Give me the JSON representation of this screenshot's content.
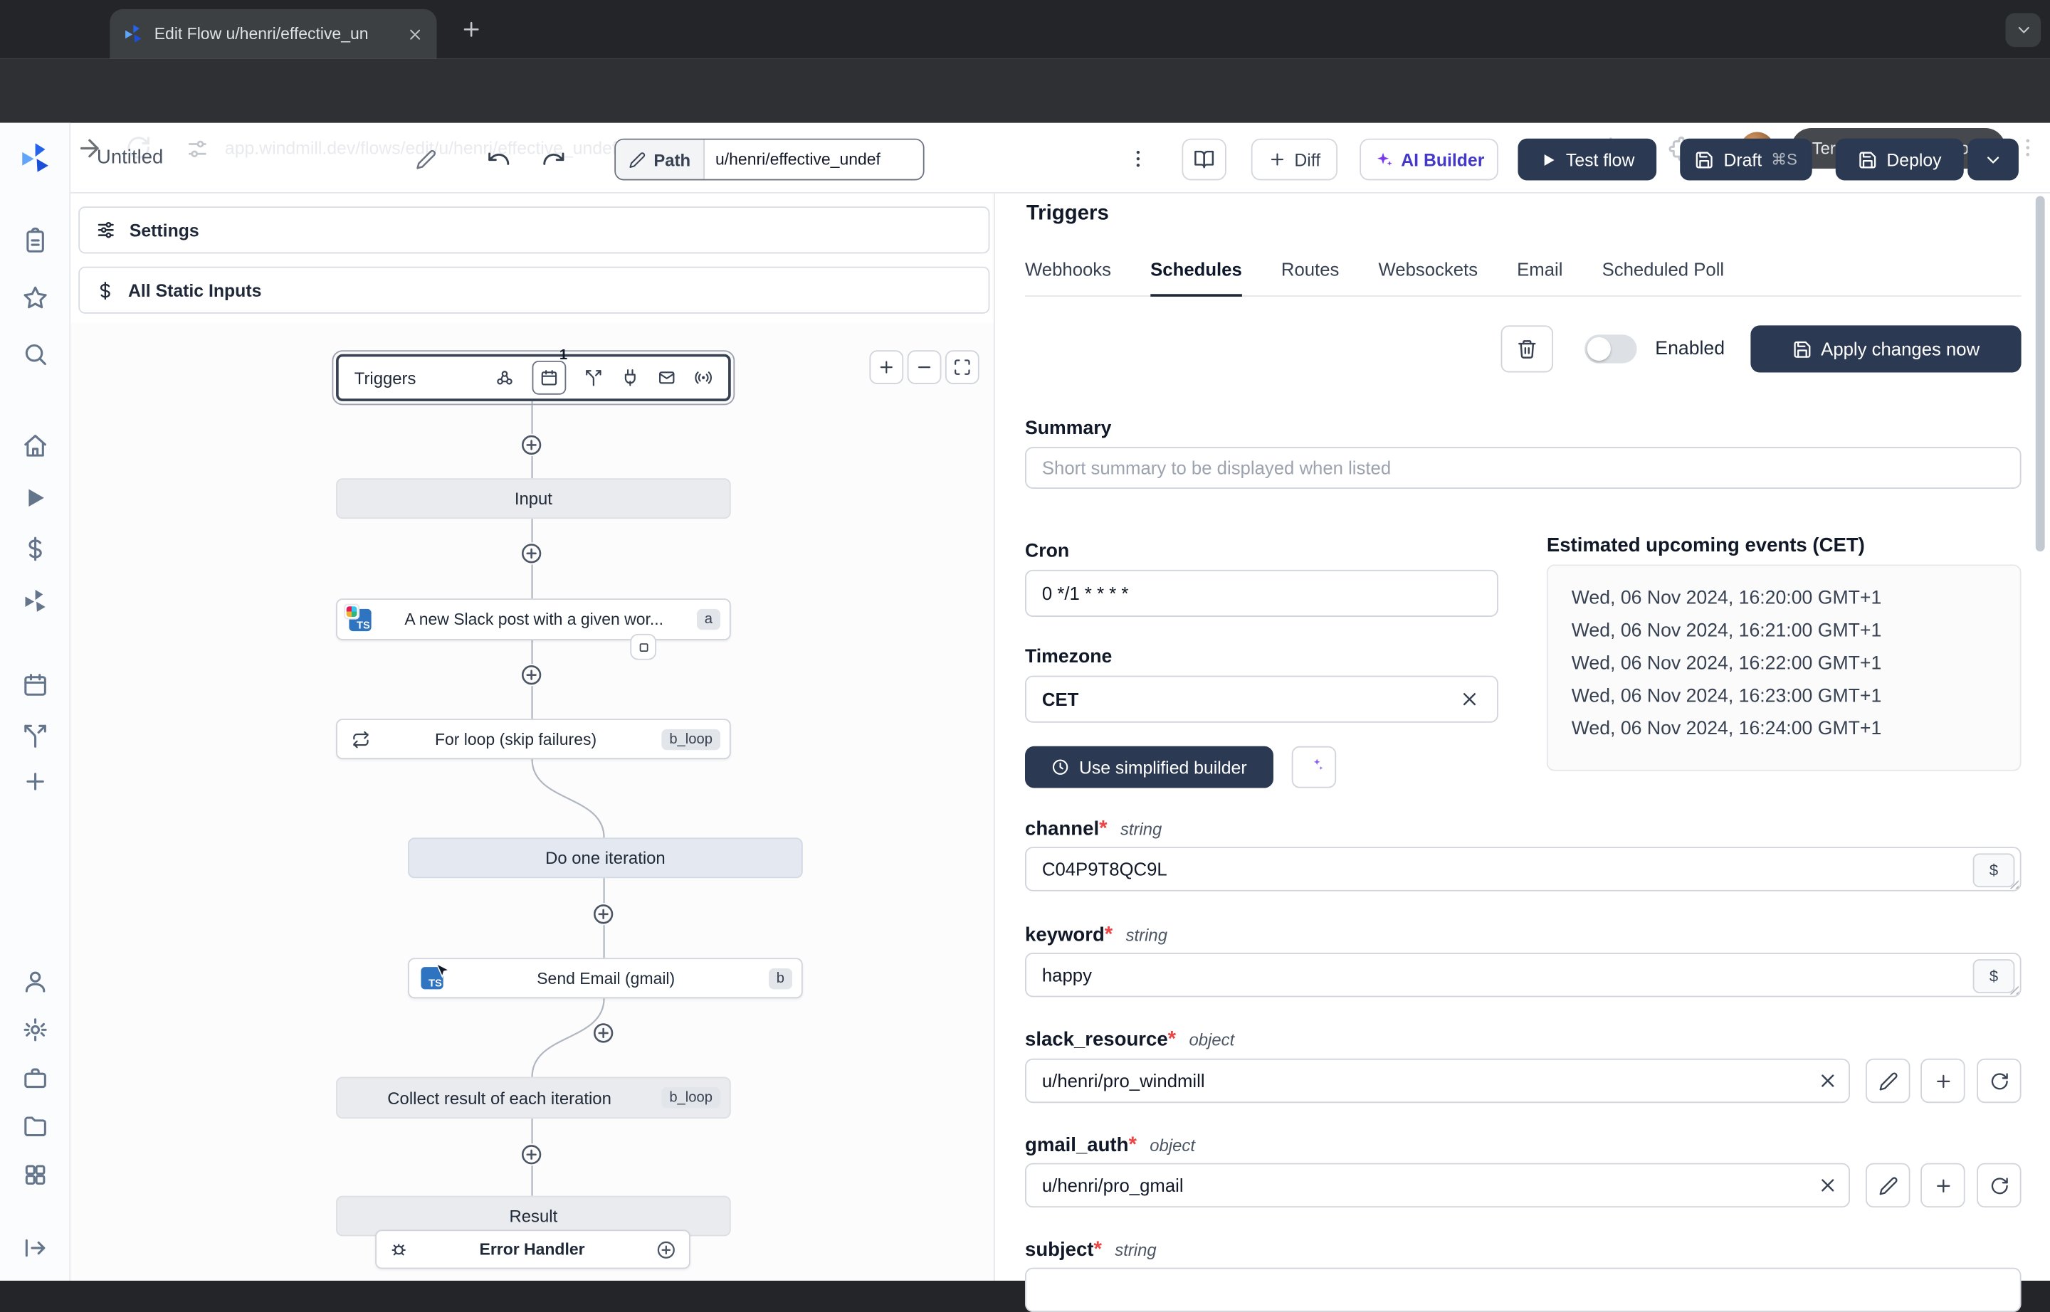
{
  "browser": {
    "tab_title": "Edit Flow u/henri/effective_un",
    "url": "app.windmill.dev/flows/edit/u/henri/effective_undefined",
    "update_button": "Terminer la mise à jour"
  },
  "toolbar": {
    "flow_title": "Untitled",
    "path_label": "Path",
    "path_value": "u/henri/effective_undef",
    "diff_label": "Diff",
    "ai_builder_label": "AI Builder",
    "test_flow_label": "Test flow",
    "draft_label": "Draft",
    "draft_shortcut": "⌘S",
    "deploy_label": "Deploy"
  },
  "left_panel": {
    "settings_label": "Settings",
    "static_inputs_label": "All Static Inputs"
  },
  "flow": {
    "triggers_label": "Triggers",
    "schedule_count": "1",
    "input_label": "Input",
    "slack_step": {
      "label": "A new Slack post with a given wor...",
      "badge": "a",
      "icon_text": "TS"
    },
    "forloop_step": {
      "label": "For loop (skip failures)",
      "badge": "b_loop"
    },
    "iteration_label": "Do one iteration",
    "email_step": {
      "label": "Send Email (gmail)",
      "badge": "b",
      "icon_text": "TS"
    },
    "collect_step": {
      "label": "Collect result of each iteration",
      "badge": "b_loop"
    },
    "result_label": "Result",
    "error_handler_label": "Error Handler"
  },
  "triggers_panel": {
    "title": "Triggers",
    "tabs": [
      "Webhooks",
      "Schedules",
      "Routes",
      "Websockets",
      "Email",
      "Scheduled Poll"
    ],
    "active_tab": "Schedules",
    "enabled_label": "Enabled",
    "apply_button": "Apply changes now",
    "summary_label": "Summary",
    "summary_placeholder": "Short summary to be displayed when listed",
    "cron_label": "Cron",
    "cron_value": "0 */1 * * * *",
    "timezone_label": "Timezone",
    "timezone_value": "CET",
    "simplified_builder_button": "Use simplified builder",
    "upcoming_title": "Estimated upcoming events (CET)",
    "upcoming_events": [
      "Wed, 06 Nov 2024, 16:20:00 GMT+1",
      "Wed, 06 Nov 2024, 16:21:00 GMT+1",
      "Wed, 06 Nov 2024, 16:22:00 GMT+1",
      "Wed, 06 Nov 2024, 16:23:00 GMT+1",
      "Wed, 06 Nov 2024, 16:24:00 GMT+1"
    ],
    "required_marker": "*",
    "dollar_button": "$",
    "fields": [
      {
        "name": "channel",
        "type": "string",
        "value": "C04P9T8QC9L"
      },
      {
        "name": "keyword",
        "type": "string",
        "value": "happy"
      },
      {
        "name": "slack_resource",
        "type": "object",
        "value": "u/henri/pro_windmill"
      },
      {
        "name": "gmail_auth",
        "type": "object",
        "value": "u/henri/pro_gmail"
      },
      {
        "name": "subject",
        "type": "string",
        "value": ""
      }
    ]
  }
}
